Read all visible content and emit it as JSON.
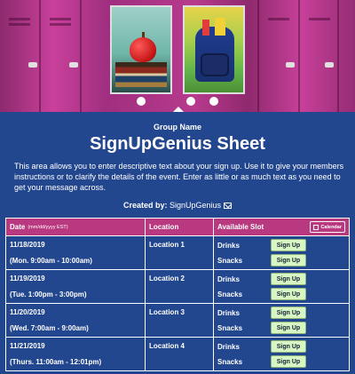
{
  "header": {
    "photos": [
      "apple-on-books-photo",
      "backpack-photo"
    ]
  },
  "group_name": "Group Name",
  "title": "SignUpGenius Sheet",
  "description": "This area allows you to enter descriptive text about your sign up. Use it to give your members instructions or to clarify the details of the event. Enter as little or as much text as you need to get your message across.",
  "created_by": {
    "label": "Created by:",
    "name": "SignUpGenius",
    "icon": "envelope-icon"
  },
  "table": {
    "headers": {
      "date": "Date",
      "date_format": "(mm/dd/yyyy EST)",
      "location": "Location",
      "slot": "Available Slot",
      "calendar": "Calendar"
    },
    "rows": [
      {
        "date": "11/18/2019",
        "time": "(Mon. 9:00am - 10:00am)",
        "location": "Location 1",
        "slots": [
          "Drinks",
          "Snacks"
        ],
        "button": "Sign Up"
      },
      {
        "date": "11/19/2019",
        "time": "(Tue. 1:00pm - 3:00pm)",
        "location": "Location 2",
        "slots": [
          "Drinks",
          "Snacks"
        ],
        "button": "Sign Up"
      },
      {
        "date": "11/20/2019",
        "time": "(Wed. 7:00am - 9:00am)",
        "location": "Location 3",
        "slots": [
          "Drinks",
          "Snacks"
        ],
        "button": "Sign Up"
      },
      {
        "date": "11/21/2019",
        "time": "(Thurs. 11:00am - 12:01pm)",
        "location": "Location 4",
        "slots": [
          "Drinks",
          "Snacks"
        ],
        "button": "Sign Up"
      }
    ]
  },
  "colors": {
    "background": "#23478f",
    "header_pink": "#b8397f",
    "signup_button": "#d8f5c4"
  }
}
